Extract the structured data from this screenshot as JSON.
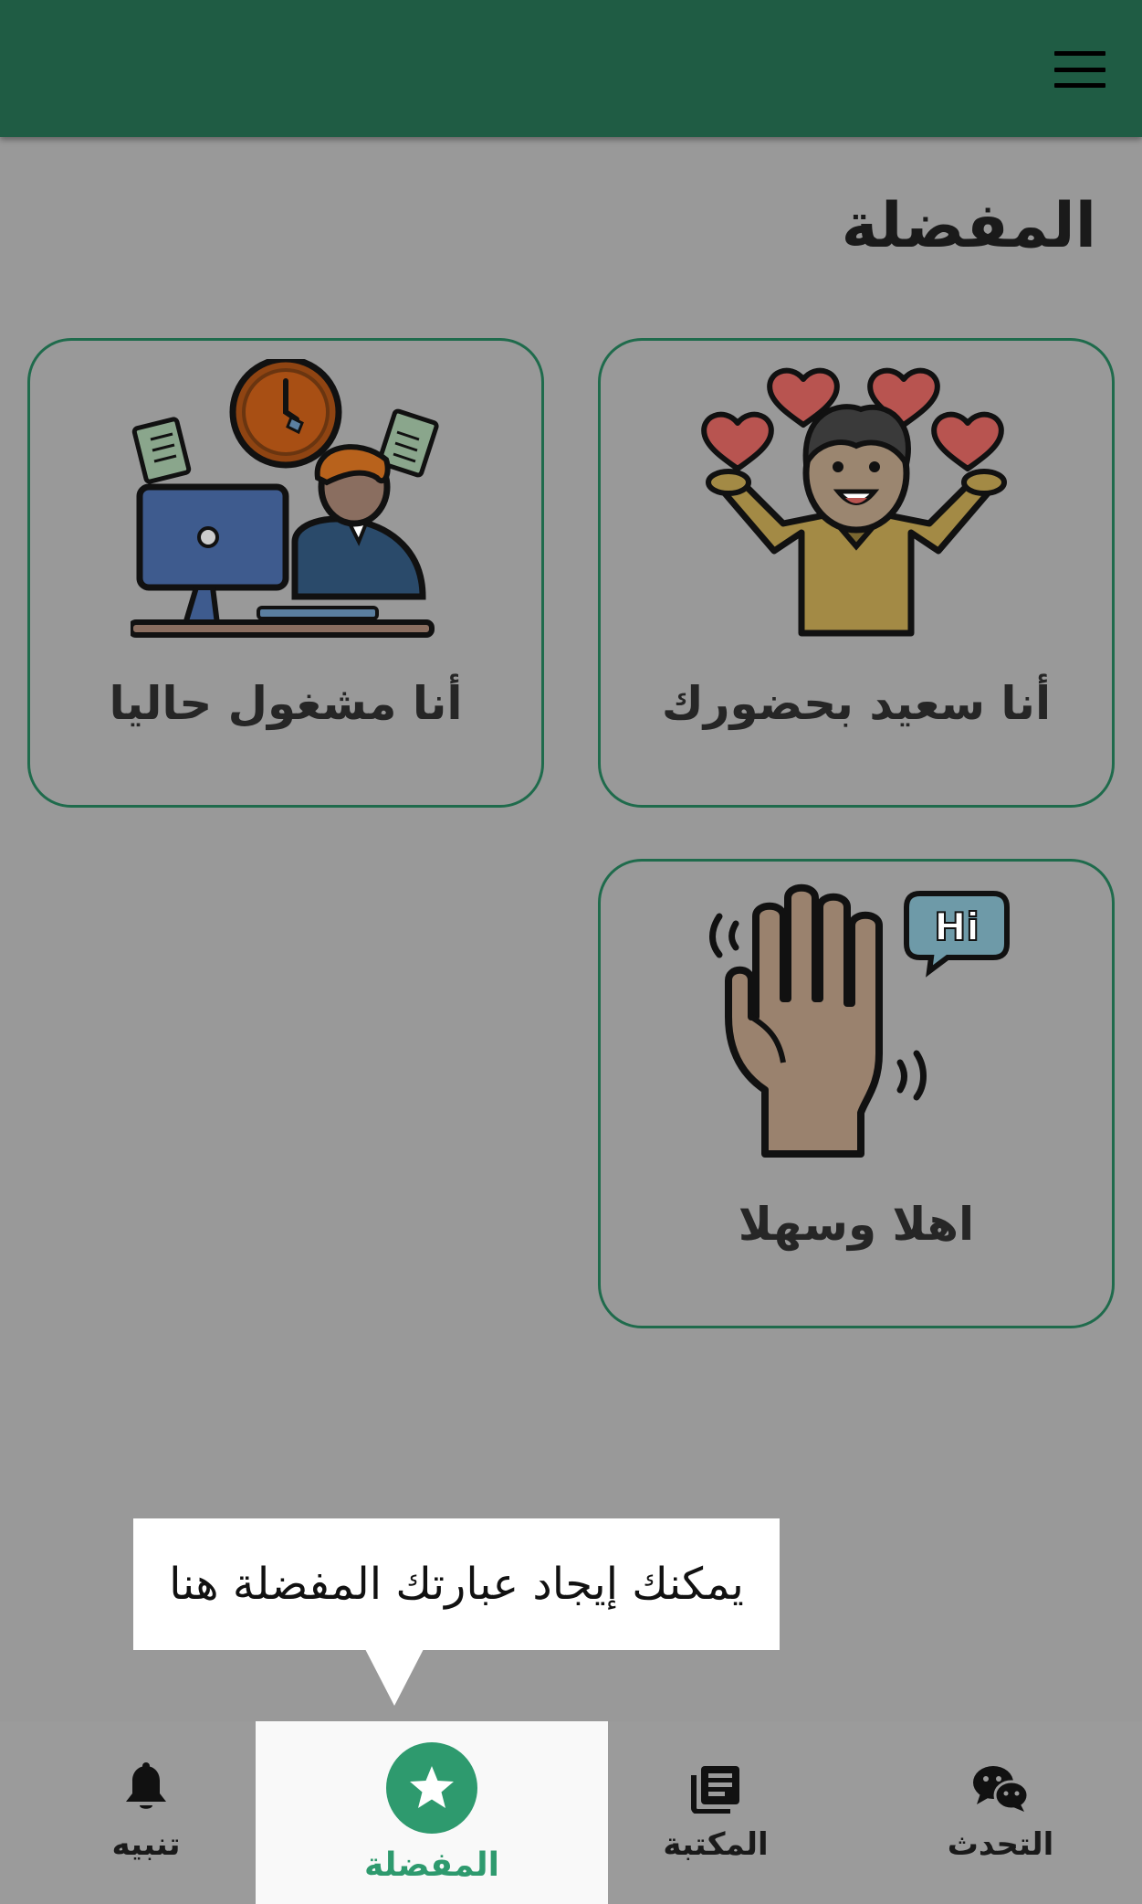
{
  "page": {
    "title": "المفضلة"
  },
  "cards": [
    {
      "label": "أنا سعيد بحضورك",
      "icon": "happy-person-hearts-icon"
    },
    {
      "label": "أنا مشغول حاليا",
      "icon": "busy-office-worker-icon"
    },
    {
      "label": "اهلا وسهلا",
      "icon": "waving-hand-hi-icon"
    }
  ],
  "tooltip": {
    "text": "يمكنك إيجاد عبارتك المفضلة هنا"
  },
  "bottom_nav": {
    "items": [
      {
        "label": "تنبيه",
        "icon": "bell-icon"
      },
      {
        "label": "المفضلة",
        "icon": "star-icon",
        "active": true
      },
      {
        "label": "المكتبة",
        "icon": "news-library-icon"
      },
      {
        "label": "التحدث",
        "icon": "chat-bubbles-icon"
      }
    ]
  },
  "colors": {
    "app_bar": "#1f5c44",
    "accent": "#2e9a6e",
    "overlay_background": "#999999",
    "card_border": "#1f6b4c"
  }
}
